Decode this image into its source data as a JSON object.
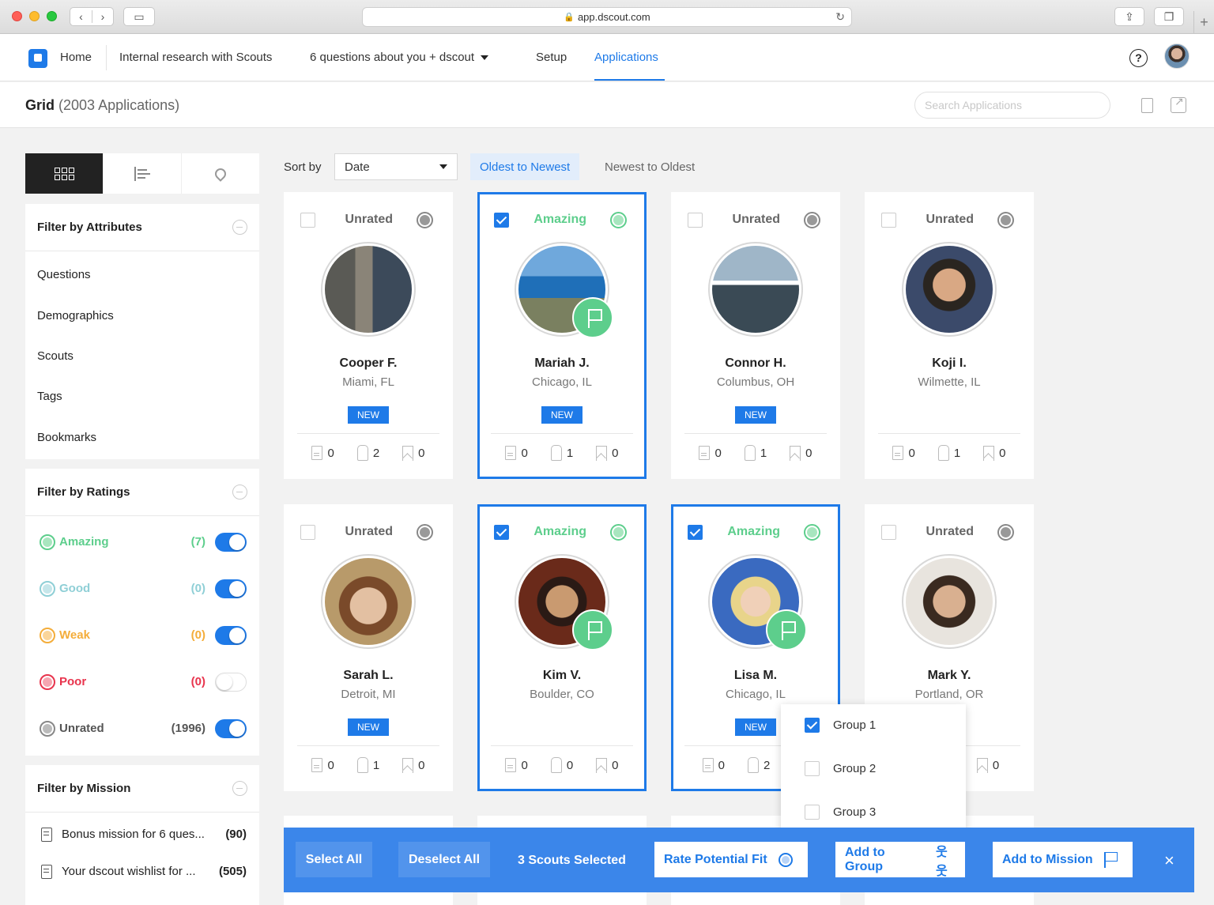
{
  "browser": {
    "url": "app.dscout.com"
  },
  "nav": {
    "items": [
      {
        "label": "Home"
      },
      {
        "label": "Internal research with Scouts"
      },
      {
        "label": "6 questions about you + dscout"
      },
      {
        "label": "Setup"
      },
      {
        "label": "Applications"
      }
    ],
    "active": "Applications",
    "help": "?"
  },
  "subheader": {
    "title": "Grid",
    "count": "(2003 Applications)",
    "search_placeholder": "Search Applications"
  },
  "sort": {
    "label": "Sort by",
    "selected": "Date",
    "order_active": "Oldest to Newest",
    "order_inactive": "Newest to Oldest"
  },
  "filters": {
    "attributes": {
      "title": "Filter by Attributes",
      "items": [
        "Questions",
        "Demographics",
        "Scouts",
        "Tags",
        "Bookmarks"
      ]
    },
    "ratings": {
      "title": "Filter by Ratings",
      "items": [
        {
          "label": "Amazing",
          "count": "(7)",
          "color": "#5dce8c",
          "fill": "#a8e6bf",
          "on": true
        },
        {
          "label": "Good",
          "count": "(0)",
          "color": "#8fcfd6",
          "fill": "#c5e6ea",
          "on": true
        },
        {
          "label": "Weak",
          "count": "(0)",
          "color": "#f4ad3a",
          "fill": "#fad59a",
          "on": true
        },
        {
          "label": "Poor",
          "count": "(0)",
          "color": "#e8344d",
          "fill": "#f5a6b1",
          "on": false
        },
        {
          "label": "Unrated",
          "count": "(1996)",
          "color": "#888888",
          "fill": "#bbbbbb",
          "on": true
        }
      ]
    },
    "mission": {
      "title": "Filter by Mission",
      "items": [
        {
          "label": "Bonus mission for 6 ques...",
          "count": "(90)"
        },
        {
          "label": "Your dscout wishlist for ...",
          "count": "(505)"
        }
      ]
    }
  },
  "cards": [
    {
      "name": "Cooper F.",
      "location": "Miami, FL",
      "rating": "Unrated",
      "selected": false,
      "flag": false,
      "badge": "NEW",
      "stats": [
        "0",
        "2",
        "0"
      ]
    },
    {
      "name": "Mariah J.",
      "location": "Chicago, IL",
      "rating": "Amazing",
      "selected": true,
      "flag": true,
      "badge": "NEW",
      "stats": [
        "0",
        "1",
        "0"
      ]
    },
    {
      "name": "Connor H.",
      "location": "Columbus, OH",
      "rating": "Unrated",
      "selected": false,
      "flag": false,
      "badge": "NEW",
      "stats": [
        "0",
        "1",
        "0"
      ]
    },
    {
      "name": "Koji I.",
      "location": "Wilmette, IL",
      "rating": "Unrated",
      "selected": false,
      "flag": false,
      "badge": "",
      "stats": [
        "0",
        "1",
        "0"
      ]
    },
    {
      "name": "Sarah L.",
      "location": "Detroit, MI",
      "rating": "Unrated",
      "selected": false,
      "flag": false,
      "badge": "NEW",
      "stats": [
        "0",
        "1",
        "0"
      ]
    },
    {
      "name": "Kim V.",
      "location": "Boulder, CO",
      "rating": "Amazing",
      "selected": true,
      "flag": true,
      "badge": "",
      "stats": [
        "0",
        "0",
        "0"
      ]
    },
    {
      "name": "Lisa M.",
      "location": "Chicago, IL",
      "rating": "Amazing",
      "selected": true,
      "flag": true,
      "badge": "NEW",
      "stats": [
        "0",
        "2",
        ""
      ]
    },
    {
      "name": "Mark Y.",
      "location": "Portland, OR",
      "rating": "Unrated",
      "selected": false,
      "flag": false,
      "badge": "",
      "stats": [
        "",
        "",
        "0"
      ]
    }
  ],
  "dropdown": {
    "items": [
      {
        "label": "Group 1",
        "checked": true
      },
      {
        "label": "Group 2",
        "checked": false
      },
      {
        "label": "Group 3",
        "checked": false
      }
    ]
  },
  "actionbar": {
    "select_all": "Select All",
    "deselect_all": "Deselect All",
    "selected_label": "3 Scouts Selected",
    "rate": "Rate Potential Fit",
    "add_group": "Add to Group",
    "add_mission": "Add to Mission",
    "close": "×"
  }
}
